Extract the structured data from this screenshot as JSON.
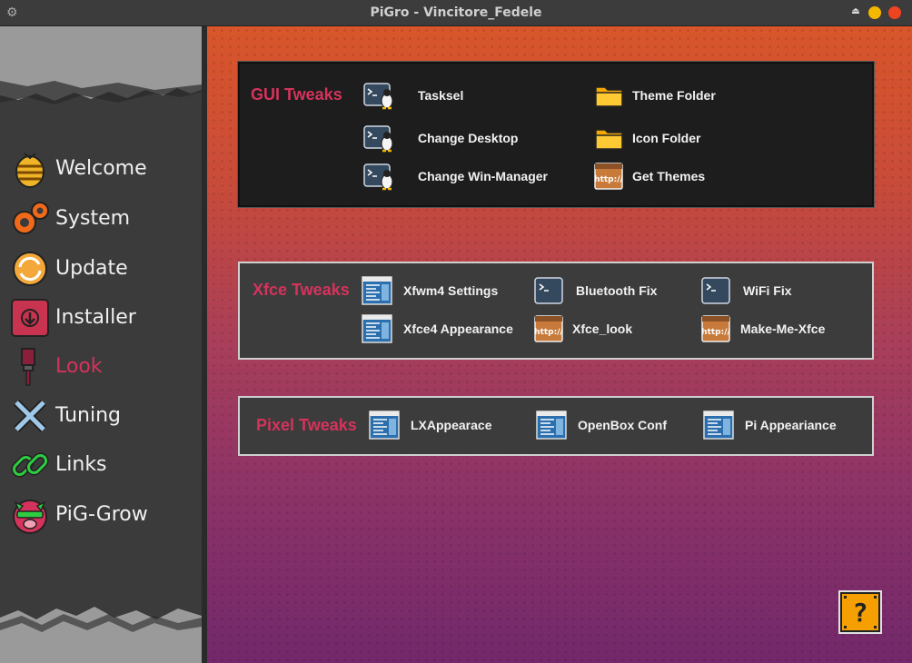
{
  "window": {
    "title": "PiGro - Vincitore_Fedele"
  },
  "sidebar": {
    "items": [
      {
        "label": "Welcome",
        "icon": "bee-hive-icon",
        "active": false
      },
      {
        "label": "System",
        "icon": "gears-icon",
        "active": false
      },
      {
        "label": "Update",
        "icon": "sync-arrows-icon",
        "active": false
      },
      {
        "label": "Installer",
        "icon": "download-icon",
        "active": false
      },
      {
        "label": "Look",
        "icon": "paint-brush-icon",
        "active": true
      },
      {
        "label": "Tuning",
        "icon": "wrench-cross-icon",
        "active": false
      },
      {
        "label": "Links",
        "icon": "chain-link-icon",
        "active": false
      },
      {
        "label": "PiG-Grow",
        "icon": "pig-icon",
        "active": false
      }
    ]
  },
  "gui_tweaks": {
    "title": "GUI Tweaks",
    "items": [
      {
        "label": "Tasksel",
        "icon": "terminal-linux-icon"
      },
      {
        "label": "Change Desktop",
        "icon": "terminal-linux-icon"
      },
      {
        "label": "Change Win-Manager",
        "icon": "terminal-linux-icon"
      },
      {
        "label": "Theme Folder",
        "icon": "folder-icon"
      },
      {
        "label": "Icon Folder",
        "icon": "folder-icon"
      },
      {
        "label": "Get Themes",
        "icon": "http-icon"
      }
    ]
  },
  "xfce_tweaks": {
    "title": "Xfce Tweaks",
    "items": [
      {
        "label": "Xfwm4 Settings",
        "icon": "settings-window-icon"
      },
      {
        "label": "Xfce4 Appearance",
        "icon": "settings-window-icon"
      },
      {
        "label": "Bluetooth Fix",
        "icon": "terminal-icon"
      },
      {
        "label": "Xfce_look",
        "icon": "http-icon"
      },
      {
        "label": "WiFi Fix",
        "icon": "terminal-icon"
      },
      {
        "label": "Make-Me-Xfce",
        "icon": "http-icon"
      }
    ]
  },
  "pixel_tweaks": {
    "title": "Pixel Tweaks",
    "items": [
      {
        "label": "LXAppearace",
        "icon": "settings-window-icon"
      },
      {
        "label": "OpenBox Conf",
        "icon": "settings-window-icon"
      },
      {
        "label": "Pi Appeariance",
        "icon": "settings-window-icon"
      }
    ]
  },
  "help": {
    "label": "?",
    "icon": "question-block-icon"
  },
  "colors": {
    "accent": "#d6335c",
    "panel_dark": "#1d1d1d",
    "panel_grey": "#3c3c3c"
  }
}
